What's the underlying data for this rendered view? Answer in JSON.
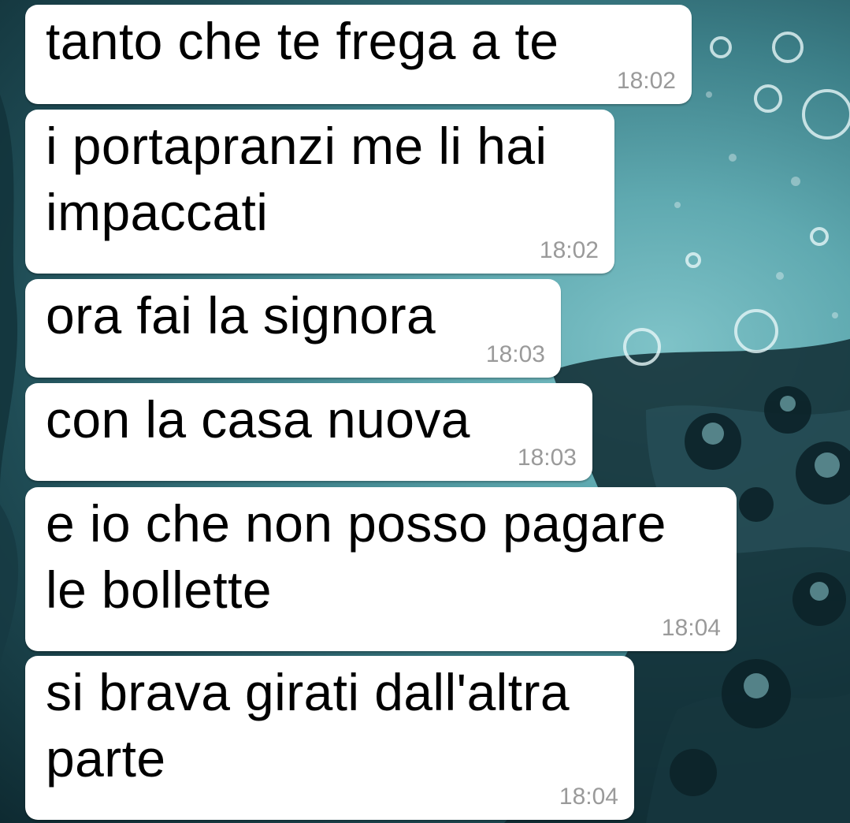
{
  "conversation": {
    "messages": [
      {
        "text": "tanto che te frega a te",
        "time": "18:02"
      },
      {
        "text": "i portapranzi me li hai\nimpaccati",
        "time": "18:02"
      },
      {
        "text": "ora fai la signora",
        "time": "18:03"
      },
      {
        "text": "con la casa nuova",
        "time": "18:03"
      },
      {
        "text": "e io che non posso pagare\nle bollette",
        "time": "18:04"
      },
      {
        "text": "si brava girati dall'altra\nparte",
        "time": "18:04"
      }
    ]
  },
  "theme": {
    "bubble_color": "#ffffff",
    "text_color": "#000000",
    "time_color": "#9a9a9a",
    "wallpaper": "water-drops"
  }
}
